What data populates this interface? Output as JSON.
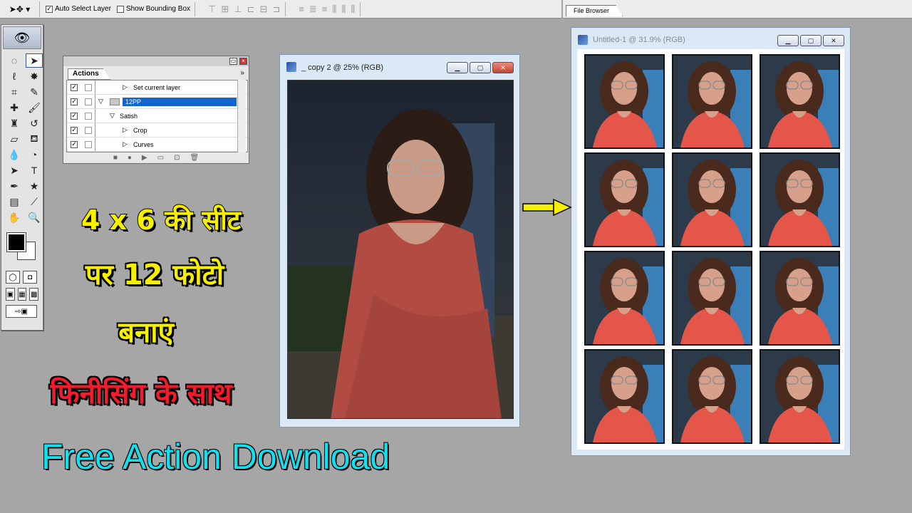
{
  "options_bar": {
    "auto_select_label": "Auto Select Layer",
    "auto_select_checked": true,
    "show_bounding_label": "Show Bounding Box",
    "show_bounding_checked": false
  },
  "file_browser": {
    "tab_label": "File Browser"
  },
  "actions_panel": {
    "tab_label": "Actions",
    "rows": [
      {
        "label": "Set current layer",
        "checked": true
      },
      {
        "label": "12PP",
        "checked": true,
        "selected": true
      },
      {
        "label": "Satish",
        "checked": true
      },
      {
        "label": "Crop",
        "checked": true
      },
      {
        "label": "Curves",
        "checked": true
      }
    ]
  },
  "document_left": {
    "title": "_ copy 2 @ 25% (RGB)"
  },
  "document_right": {
    "title": "Untitled-1 @ 31.9% (RGB)",
    "photo_count": 12
  },
  "overlay_text": {
    "line1": "4 x 6  की सीट",
    "line2": "पर 12 फोटो",
    "line3": "बनाएं",
    "line4": "फिनीसिंग के साथ",
    "line5": "Free Action Download"
  },
  "colors": {
    "yellow_text": "#f6f000",
    "red_text": "#f61b2c",
    "cyan_text": "#12e0ef",
    "selection_blue": "#1066cc",
    "window_frame": "#dbe9f7"
  }
}
